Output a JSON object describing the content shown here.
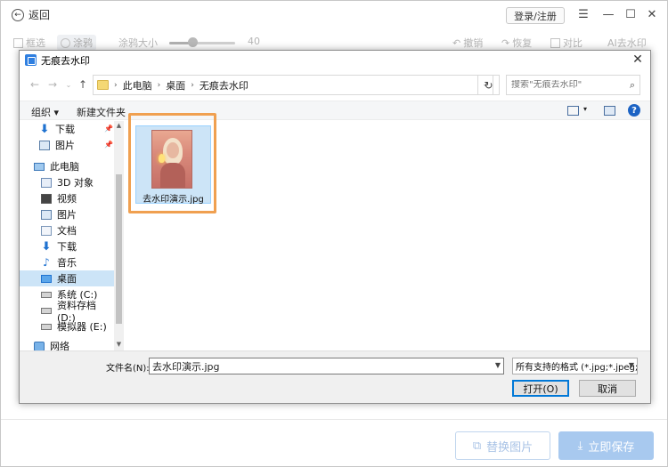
{
  "app": {
    "back_label": "返回",
    "login_label": "登录/注册",
    "toolbar": {
      "marquee_label": "框选",
      "paint_label": "涂鸦",
      "brush_size_label": "涂鸦大小",
      "brush_size_value": "40",
      "undo_label": "撤销",
      "redo_label": "恢复",
      "compare_label": "对比",
      "ai_label": "AI去水印"
    },
    "replace_label": "替换图片",
    "save_label": "立即保存",
    "brush_level": 0.35
  },
  "dialog": {
    "title": "无痕去水印",
    "breadcrumb": [
      "此电脑",
      "桌面",
      "无痕去水印"
    ],
    "search_placeholder": "搜索\"无痕去水印\"",
    "organize_label": "组织 ▾",
    "new_folder_label": "新建文件夹",
    "nav_items": [
      {
        "label": "下载",
        "icon": "download-icon",
        "pinned": true
      },
      {
        "label": "图片",
        "icon": "pictures-icon",
        "pinned": true
      },
      {
        "label": "此电脑",
        "icon": "computer-icon"
      },
      {
        "label": "3D 对象",
        "icon": "3d-objects-icon"
      },
      {
        "label": "视频",
        "icon": "video-icon"
      },
      {
        "label": "图片",
        "icon": "pictures-icon"
      },
      {
        "label": "文档",
        "icon": "documents-icon"
      },
      {
        "label": "下载",
        "icon": "download-icon"
      },
      {
        "label": "音乐",
        "icon": "music-icon"
      },
      {
        "label": "桌面",
        "icon": "desktop-icon",
        "selected": true
      },
      {
        "label": "系统 (C:)",
        "icon": "drive-icon"
      },
      {
        "label": "资料存档 (D:)",
        "icon": "drive-icon"
      },
      {
        "label": "模拟器 (E:)",
        "icon": "drive-icon"
      },
      {
        "label": "网络",
        "icon": "network-icon"
      }
    ],
    "file": {
      "name": "去水印演示.jpg"
    },
    "filename_label": "文件名(N):",
    "filename_value": "去水印演示.jpg",
    "filter_value": "所有支持的格式 (*.jpg;*.jpeg;*",
    "open_label": "打开(O)",
    "cancel_label": "取消"
  },
  "colors": {
    "accent": "#0078d7",
    "highlight": "#f0a050",
    "save_btn": "#a8c9ef",
    "selection": "#cce4f7"
  }
}
